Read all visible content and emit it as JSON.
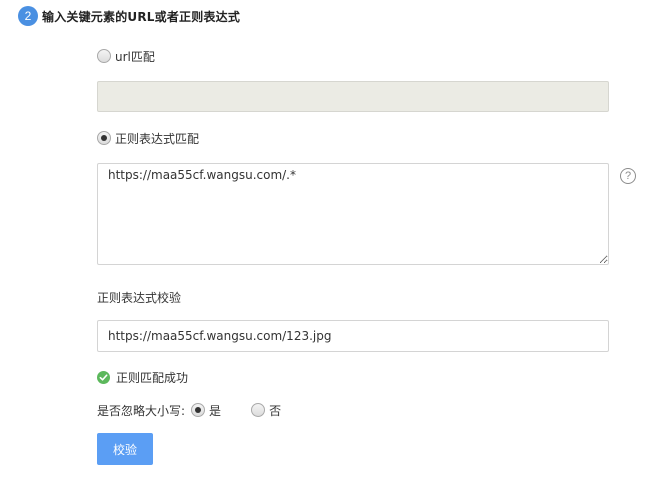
{
  "step": {
    "number": "2",
    "title": "输入关键元素的URL或者正则表达式"
  },
  "url_match": {
    "label": "url匹配",
    "selected": false,
    "input_value": ""
  },
  "regex_match": {
    "label": "正则表达式匹配",
    "selected": true,
    "textarea_value": "https://maa55cf.wangsu.com/.*"
  },
  "help": {
    "glyph": "?"
  },
  "regex_test": {
    "label": "正则表达式校验",
    "input_value": "https://maa55cf.wangsu.com/123.jpg"
  },
  "result": {
    "text": "正则匹配成功",
    "status_color": "#5cb85c"
  },
  "ignore_case": {
    "label": "是否忽略大小写:",
    "options": [
      {
        "label": "是",
        "selected": true
      },
      {
        "label": "否",
        "selected": false
      }
    ]
  },
  "actions": {
    "verify_label": "校验"
  },
  "colors": {
    "accent": "#5b9ef4",
    "step_badge": "#4a90e2",
    "disabled_bg": "#ebebe4"
  }
}
